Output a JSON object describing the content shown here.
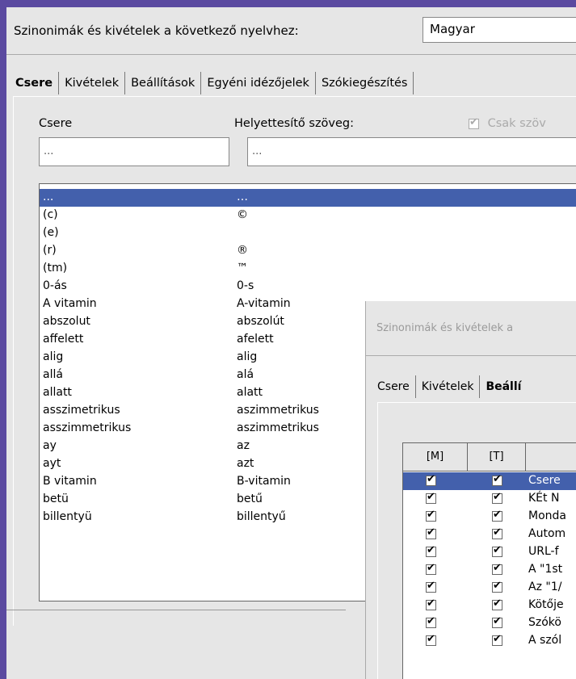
{
  "header": {
    "label": "Szinonimák és kivételek a következő nyelvhez:",
    "language": "Magyar"
  },
  "tabs": [
    "Csere",
    "Kivételek",
    "Beállítások",
    "Egyéni idézőjelek",
    "Szókiegészítés"
  ],
  "form": {
    "replace_label": "Csere",
    "with_label": "Helyettesítő szöveg:",
    "text_only_label": "Csak szöv",
    "replace_value": "...",
    "with_value": "...",
    "text_only_checked": true
  },
  "rows": [
    {
      "a": "...",
      "b": "…"
    },
    {
      "a": "(c)",
      "b": "©"
    },
    {
      "a": "(e)",
      "b": ""
    },
    {
      "a": "(r)",
      "b": "®"
    },
    {
      "a": "(tm)",
      "b": "™"
    },
    {
      "a": "0-ás",
      "b": "0-s"
    },
    {
      "a": "A vitamin",
      "b": "A-vitamin"
    },
    {
      "a": "abszolut",
      "b": "abszolút"
    },
    {
      "a": "affelett",
      "b": "afelett"
    },
    {
      "a": "alig",
      "b": "alig"
    },
    {
      "a": "allá",
      "b": "alá"
    },
    {
      "a": "allatt",
      "b": "alatt"
    },
    {
      "a": "asszimetrikus",
      "b": "aszimmetrikus"
    },
    {
      "a": "asszimmetrikus",
      "b": "aszimmetrikus"
    },
    {
      "a": "ay",
      "b": "az"
    },
    {
      "a": "ayt",
      "b": "azt"
    },
    {
      "a": "B vitamin",
      "b": "B-vitamin"
    },
    {
      "a": "betü",
      "b": "betű"
    },
    {
      "a": "billentyü",
      "b": "billentyű"
    }
  ],
  "second_dialog": {
    "title": "Szinonimák és kivételek a",
    "tabs": [
      "Csere",
      "Kivételek",
      "Beállí"
    ],
    "columns": [
      "[M]",
      "[T]",
      ""
    ],
    "options": [
      {
        "m": true,
        "t": true,
        "label": "Csere"
      },
      {
        "m": true,
        "t": true,
        "label": "KÉt N"
      },
      {
        "m": true,
        "t": true,
        "label": "Monda"
      },
      {
        "m": true,
        "t": true,
        "label": "Autom"
      },
      {
        "m": true,
        "t": true,
        "label": "URL-f"
      },
      {
        "m": true,
        "t": true,
        "label": "A \"1st"
      },
      {
        "m": true,
        "t": true,
        "label": "Az \"1/"
      },
      {
        "m": true,
        "t": true,
        "label": "Kötője"
      },
      {
        "m": true,
        "t": true,
        "label": "Szókö"
      },
      {
        "m": true,
        "t": true,
        "label": "A szól"
      }
    ]
  },
  "colors": {
    "selection": "#4360ac",
    "desktop": "#5b4aa0"
  }
}
